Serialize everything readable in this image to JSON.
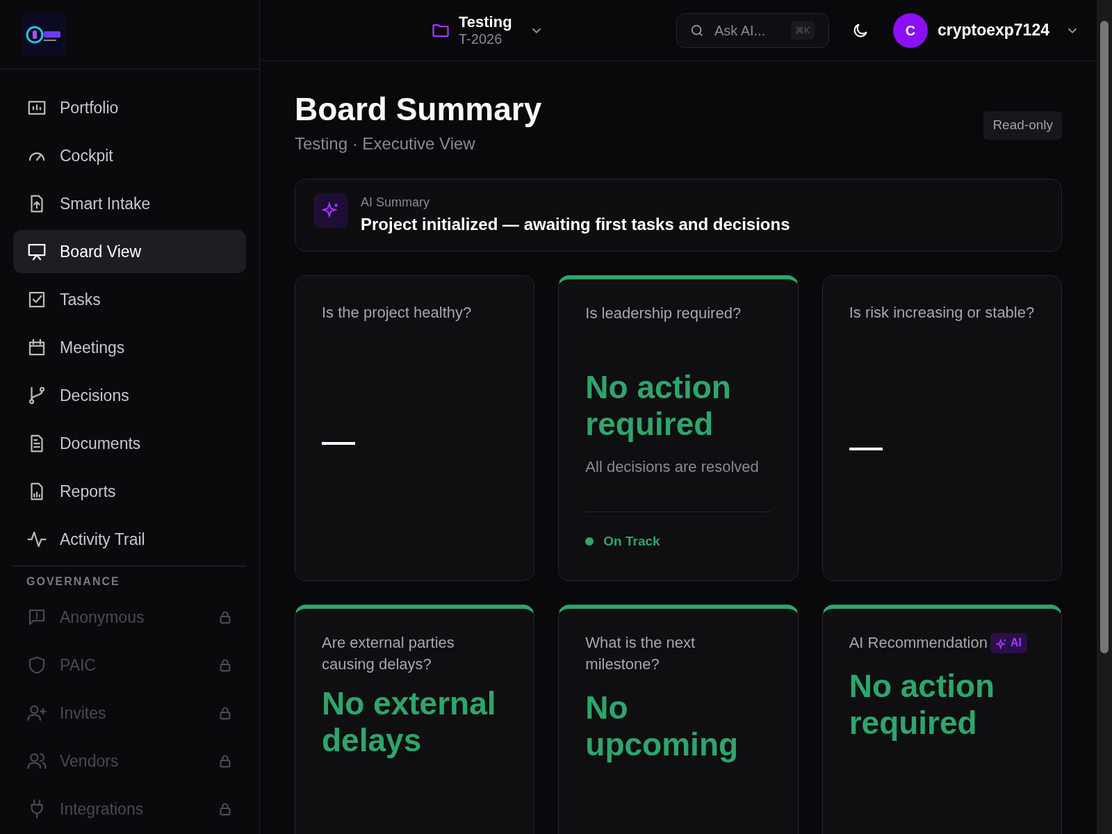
{
  "sidebar": {
    "items": [
      {
        "label": "Portfolio",
        "selected": false,
        "locked": false
      },
      {
        "label": "Cockpit",
        "selected": false,
        "locked": false
      },
      {
        "label": "Smart Intake",
        "selected": false,
        "locked": false
      },
      {
        "label": "Board View",
        "selected": true,
        "locked": false
      },
      {
        "label": "Tasks",
        "selected": false,
        "locked": false
      },
      {
        "label": "Meetings",
        "selected": false,
        "locked": false
      },
      {
        "label": "Decisions",
        "selected": false,
        "locked": false
      },
      {
        "label": "Documents",
        "selected": false,
        "locked": false
      },
      {
        "label": "Reports",
        "selected": false,
        "locked": false
      },
      {
        "label": "Activity Trail",
        "selected": false,
        "locked": false
      }
    ],
    "section_title": "GOVERNANCE",
    "governance_items": [
      {
        "label": "Anonymous",
        "selected": false,
        "locked": true
      },
      {
        "label": "PAIC",
        "selected": false,
        "locked": true
      },
      {
        "label": "Invites",
        "selected": false,
        "locked": true
      },
      {
        "label": "Vendors",
        "selected": false,
        "locked": true
      },
      {
        "label": "Integrations",
        "selected": false,
        "locked": true
      }
    ]
  },
  "header": {
    "project_name": "Testing",
    "project_code": "T-2026",
    "search": {
      "placeholder": "Ask AI...",
      "shortcut": "⌘K"
    },
    "user": {
      "initial": "C",
      "name": "cryptoexp7124"
    }
  },
  "page": {
    "title": "Board Summary",
    "subtitle": "Testing · Executive View",
    "badge": "Read-only"
  },
  "ai_summary": {
    "label": "AI Summary",
    "text": "Project initialized — awaiting first tasks and decisions"
  },
  "cards": [
    {
      "kind": "empty",
      "accent": false,
      "question": "Is the project healthy?"
    },
    {
      "kind": "answer",
      "accent": true,
      "question": "Is leadership required?",
      "answer": "No action required",
      "detail": "All decisions are resolved",
      "status": {
        "label": "On Track",
        "color": "#2ea66b"
      }
    },
    {
      "kind": "empty",
      "accent": false,
      "question": "Is risk increasing or stable?"
    },
    {
      "kind": "answer",
      "accent": true,
      "question": "Are external parties causing delays?",
      "answer": "No external delays"
    },
    {
      "kind": "answer",
      "accent": true,
      "question": "What is the next milestone?",
      "answer": "No upcoming"
    },
    {
      "kind": "answer",
      "accent": true,
      "question": "AI Recommendation",
      "ai_badge": "AI",
      "answer": "No action required"
    }
  ]
}
